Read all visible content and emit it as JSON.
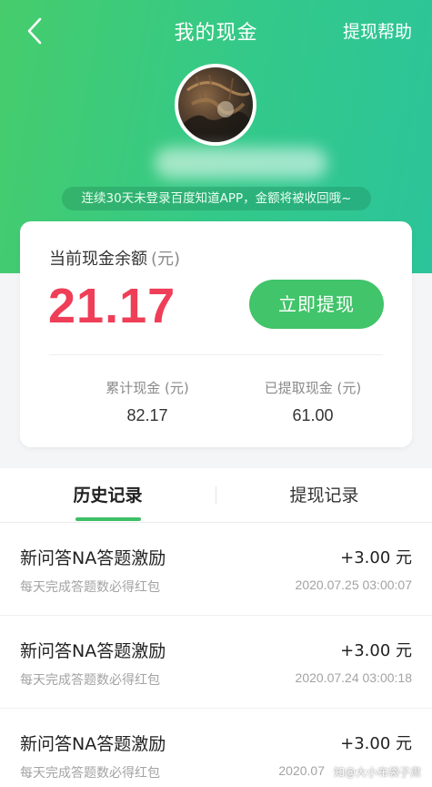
{
  "header": {
    "title": "我的现金",
    "help_label": "提现帮助",
    "back_icon": "chevron-left-icon",
    "gradient_start": "#46cc6c",
    "gradient_end": "#2cc49a"
  },
  "profile": {
    "notice": "连续30天未登录百度知道APP，金额将被收回哦~"
  },
  "balance": {
    "label": "当前现金余额",
    "unit": "(元)",
    "amount": "21.17",
    "amount_color": "#ef3e58",
    "withdraw_label": "立即提现",
    "button_color": "#41c46a",
    "total_label": "累计现金 (元)",
    "total_value": "82.17",
    "withdrawn_label": "已提取现金 (元)",
    "withdrawn_value": "61.00"
  },
  "tabs": [
    {
      "label": "历史记录",
      "active": true
    },
    {
      "label": "提现记录",
      "active": false
    }
  ],
  "records": [
    {
      "title": "新问答NA答题激励",
      "amount": "+3.00 元",
      "desc": "每天完成答题数必得红包",
      "time": "2020.07.25 03:00:07"
    },
    {
      "title": "新问答NA答题激励",
      "amount": "+3.00 元",
      "desc": "每天完成答题数必得红包",
      "time": "2020.07.24 03:00:18"
    },
    {
      "title": "新问答NA答题激励",
      "amount": "+3.00 元",
      "desc": "每天完成答题数必得红包",
      "time": "2020.07"
    }
  ],
  "watermark": "知@大小布袋子肃"
}
